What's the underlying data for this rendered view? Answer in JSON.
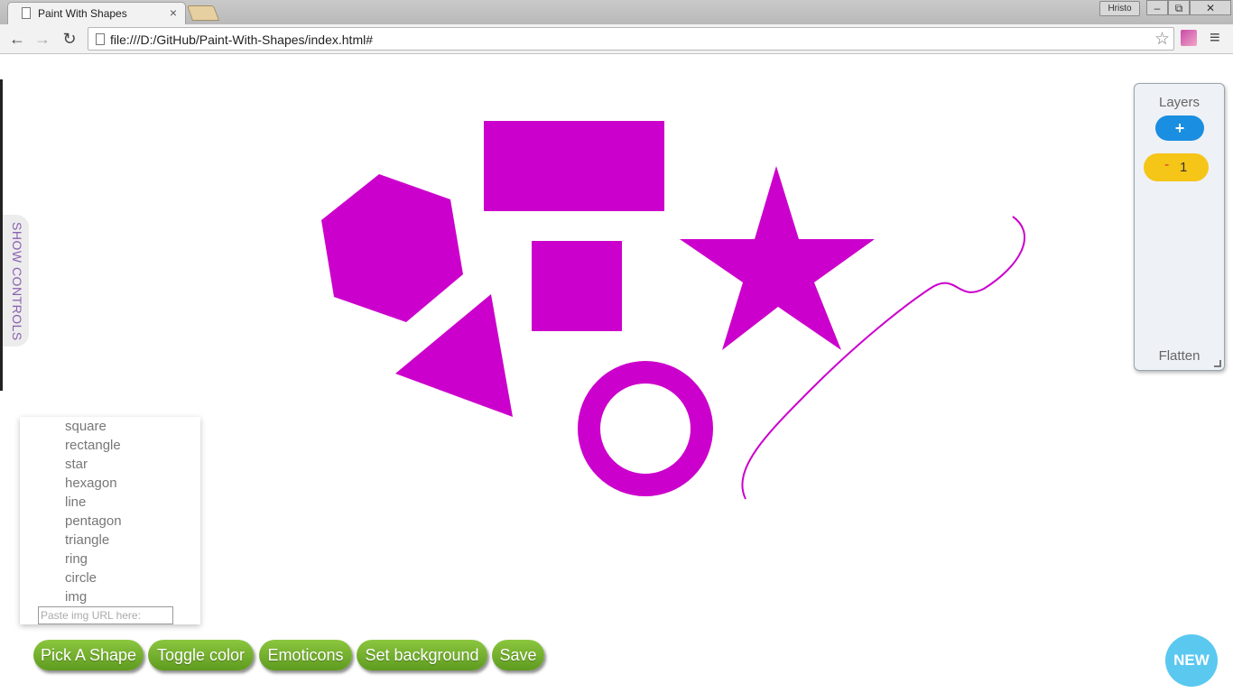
{
  "browser": {
    "tab_title": "Paint With Shapes",
    "tab_close": "×",
    "url": "file:///D:/GitHub/Paint-With-Shapes/index.html#",
    "user": "Hristo",
    "min_glyph": "–",
    "max_glyph": "⧉",
    "close_glyph": "✕",
    "back_glyph": "←",
    "forward_glyph": "→",
    "reload_glyph": "↻",
    "star_glyph": "☆",
    "menu_glyph": "≡"
  },
  "sidebar": {
    "show_controls": "SHOW CONTROLS"
  },
  "layers": {
    "title": "Layers",
    "add": "+",
    "remove": "-",
    "items": [
      "1"
    ],
    "flatten": "Flatten"
  },
  "shape_list": {
    "items": [
      "square",
      "rectangle",
      "star",
      "hexagon",
      "line",
      "pentagon",
      "triangle",
      "ring",
      "circle",
      "img"
    ],
    "url_placeholder": "Paste img URL here:"
  },
  "buttons": {
    "pick_shape": "Pick A Shape",
    "toggle_color": "Toggle color",
    "emoticons": "Emoticons",
    "set_background": "Set background",
    "save": "Save",
    "new": "NEW"
  },
  "colors": {
    "shape_fill": "#cc00cc",
    "button_green": "#7ab22e",
    "layer_yellow": "#f5c518",
    "add_blue": "#1a8ee0",
    "new_blue": "#5bc8f0"
  }
}
